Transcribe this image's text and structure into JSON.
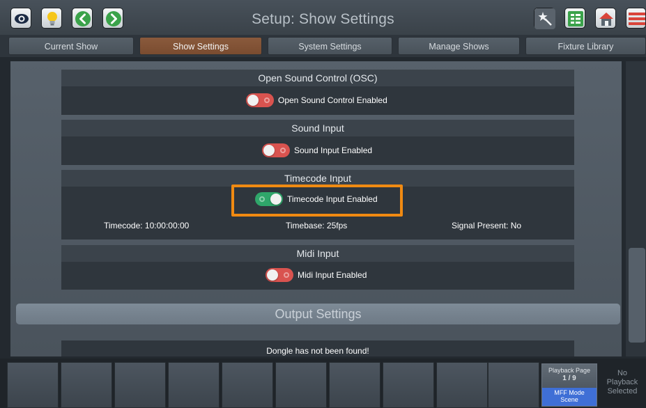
{
  "title": "Setup: Show Settings",
  "toolbar": {
    "left_icons": [
      "eye-icon",
      "lightbulb-icon",
      "back-arrow-icon",
      "forward-arrow-icon"
    ],
    "right_icons": [
      "magic-wand-icon",
      "list-icon",
      "home-icon",
      "menu-icon"
    ]
  },
  "tabs": [
    {
      "label": "Current Show",
      "active": false
    },
    {
      "label": "Show Settings",
      "active": true
    },
    {
      "label": "System Settings",
      "active": false
    },
    {
      "label": "Manage Shows",
      "active": false
    },
    {
      "label": "Fixture Library",
      "active": false
    }
  ],
  "sections": {
    "osc": {
      "title": "Open Sound Control (OSC)",
      "toggle_label": "Open Sound Control Enabled",
      "enabled": false
    },
    "sound": {
      "title": "Sound Input",
      "toggle_label": "Sound Input Enabled",
      "enabled": false
    },
    "timecode": {
      "title": "Timecode Input",
      "toggle_label": "Timecode Input Enabled",
      "enabled": true,
      "timecode": "Timecode: 10:00:00:00",
      "timebase": "Timebase: 25fps",
      "signal": "Signal Present: No"
    },
    "midi": {
      "title": "Midi Input",
      "toggle_label": "Midi Input Enabled",
      "enabled": false
    }
  },
  "output": {
    "title": "Output Settings",
    "dongle_message": "Dongle has not been found!"
  },
  "bottom": {
    "playback_page_label": "Playback Page",
    "playback_page_value": "1 / 9",
    "mff_mode_label": "MFF Mode",
    "mff_mode_value": "Scene",
    "no_playback_1": "No",
    "no_playback_2": "Playback",
    "no_playback_3": "Selected"
  },
  "colors": {
    "active_tab": "#7a4c30",
    "toggle_on": "#2fa66a",
    "toggle_off": "#d9534f",
    "highlight": "#f08a12",
    "mff_mode": "#3f6fd6"
  }
}
